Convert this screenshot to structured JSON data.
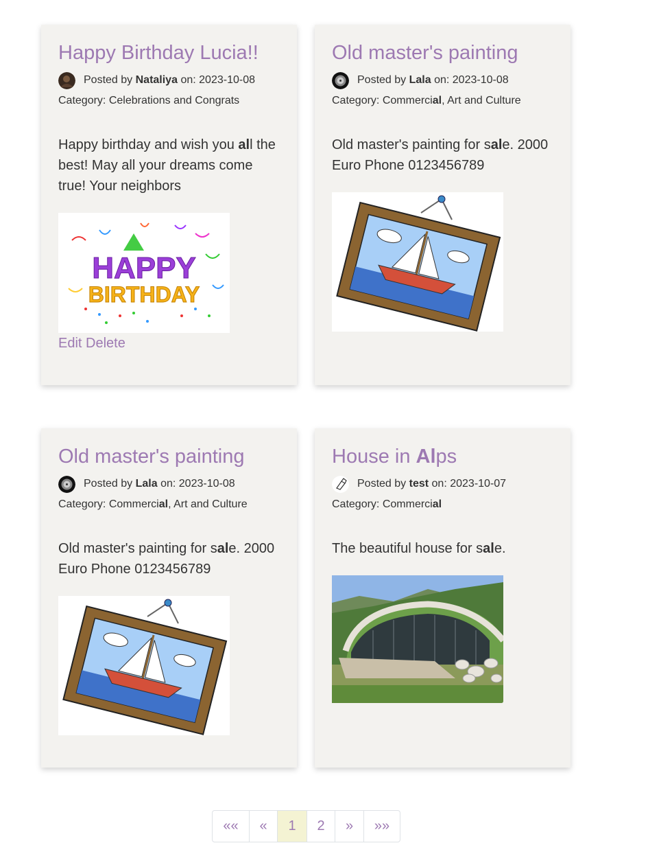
{
  "posts": [
    {
      "title": "Happy Birthday Lucia!!",
      "posted_by_prefix": "Posted by",
      "author": "Nataliya",
      "on_prefix": "on:",
      "date": "2023-10-08",
      "category_prefix": "Category:",
      "category": "Celebrations and Congrats",
      "body_1": "Happy birthday and wish you ",
      "body_hl": "al",
      "body_2": "l the best! May all your dreams come true! Your neighbors",
      "image": "happy-birthday-image",
      "edit_label": "Edit",
      "delete_label": "Delete"
    },
    {
      "title": "Old master's painting",
      "posted_by_prefix": "Posted by",
      "author": "Lala",
      "on_prefix": "on:",
      "date": "2023-10-08",
      "category_prefix": "Category:",
      "category_1": "Commerci",
      "category_hl": "al",
      "category_2": ", Art and Culture",
      "body_1": "Old master's painting for s",
      "body_hl": "al",
      "body_2": "e. 2000 Euro Phone 0123456789",
      "image": "painting-image"
    },
    {
      "title": "Old master's painting",
      "posted_by_prefix": "Posted by",
      "author": "Lala",
      "on_prefix": "on:",
      "date": "2023-10-08",
      "category_prefix": "Category:",
      "category_1": "Commerci",
      "category_hl": "al",
      "category_2": ", Art and Culture",
      "body_1": "Old master's painting for s",
      "body_hl": "al",
      "body_2": "e. 2000 Euro Phone 0123456789",
      "image": "painting-image"
    },
    {
      "title_1": "House in ",
      "title_hl": "Al",
      "title_2": "ps",
      "posted_by_prefix": "Posted by",
      "author": "test",
      "on_prefix": "on:",
      "date": "2023-10-07",
      "category_prefix": "Category:",
      "category_1": "Commerci",
      "category_hl": "al",
      "body_1": "The beautiful house for s",
      "body_hl": "al",
      "body_2": "e.",
      "image": "alps-house-image"
    }
  ],
  "pagination": {
    "first": "««",
    "prev": "«",
    "pages": [
      "1",
      "2"
    ],
    "current": "1",
    "next": "»",
    "last": "»»"
  },
  "colors": {
    "link": "#9d79b2",
    "card_bg": "#f3f2ef",
    "active_page_bg": "#f4f3d3"
  }
}
